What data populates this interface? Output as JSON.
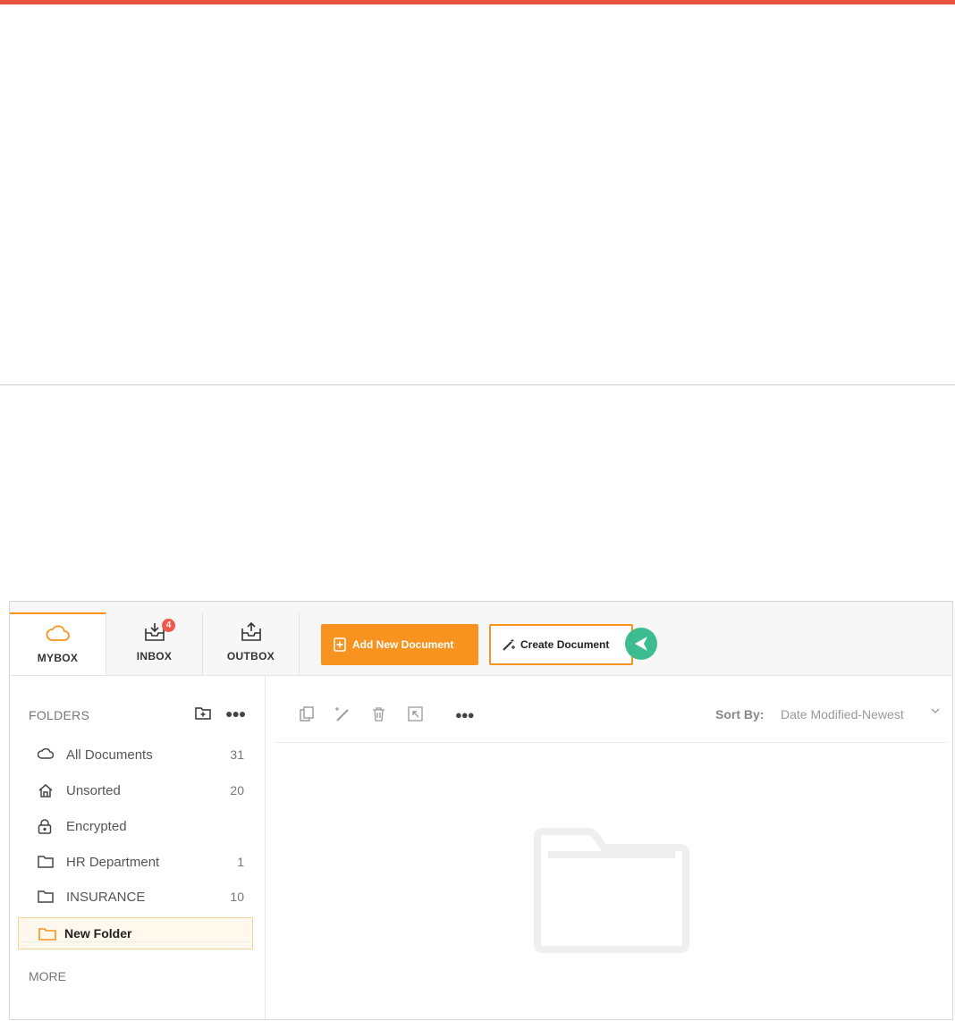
{
  "tabs": {
    "mybox": "MYBOX",
    "inbox": "INBOX",
    "inbox_badge": "4",
    "outbox": "OUTBOX"
  },
  "actions": {
    "add_new_document": "Add New Document",
    "create_document": "Create Document"
  },
  "sidebar": {
    "folders_label": "FOLDERS",
    "more_label": "MORE",
    "items": [
      {
        "icon": "cloud-icon",
        "label": "All Documents",
        "count": "31"
      },
      {
        "icon": "home-icon",
        "label": "Unsorted",
        "count": "20"
      },
      {
        "icon": "lock-icon",
        "label": "Encrypted",
        "count": ""
      },
      {
        "icon": "folder-icon",
        "label": "HR Department",
        "count": "1"
      },
      {
        "icon": "folder-icon",
        "label": "INSURANCE",
        "count": "10"
      },
      {
        "icon": "folder-icon",
        "label": "New Folder",
        "count": "",
        "selected": true
      }
    ]
  },
  "sort": {
    "label": "Sort By:",
    "value": "Date Modified-Newest"
  },
  "colors": {
    "accent": "#f7931e",
    "top_bar": "#e8533f",
    "badge": "#f0584b",
    "pointer": "#3dbd8f"
  }
}
